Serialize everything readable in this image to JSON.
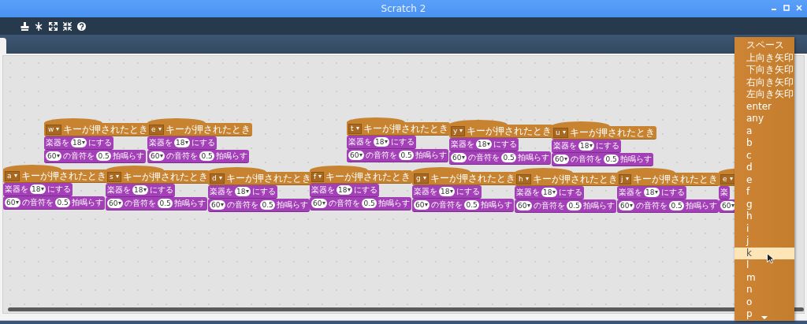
{
  "window": {
    "title": "Scratch 2"
  },
  "scripts": [
    {
      "key": "w",
      "hat_label": "キーが押されたとき",
      "instrument": {
        "label": "楽器を",
        "value": "18",
        "suffix": "にする"
      },
      "note": {
        "value": "60",
        "label": "の音符を",
        "beats": "0.5",
        "suffix": "拍鳴らす"
      }
    },
    {
      "key": "e",
      "hat_label": "キーが押されたとき",
      "instrument": {
        "label": "楽器を",
        "value": "18",
        "suffix": "にする"
      },
      "note": {
        "value": "60",
        "label": "の音符を",
        "beats": "0.5",
        "suffix": "拍鳴らす"
      }
    },
    {
      "key": "t",
      "hat_label": "キーが押されたとき",
      "instrument": {
        "label": "楽器を",
        "value": "18",
        "suffix": "にする"
      },
      "note": {
        "value": "60",
        "label": "の音符を",
        "beats": "0.5",
        "suffix": "拍鳴らす"
      }
    },
    {
      "key": "y",
      "hat_label": "キーが押されたとき",
      "instrument": {
        "label": "楽器を",
        "value": "18",
        "suffix": "にする"
      },
      "note": {
        "value": "60",
        "label": "の音符を",
        "beats": "0.5",
        "suffix": "拍鳴らす"
      }
    },
    {
      "key": "u",
      "hat_label": "キーが押されたとき",
      "instrument": {
        "label": "楽器を",
        "value": "18",
        "suffix": "にする"
      },
      "note": {
        "value": "60",
        "label": "の音符を",
        "beats": "0.5",
        "suffix": "拍鳴らす"
      }
    },
    {
      "key": "a",
      "hat_label": "キーが押されたとき",
      "instrument": {
        "label": "楽器を",
        "value": "18",
        "suffix": "にする"
      },
      "note": {
        "value": "60",
        "label": "の音符を",
        "beats": "0.5",
        "suffix": "拍鳴らす"
      }
    },
    {
      "key": "s",
      "hat_label": "キーが押されたとき",
      "instrument": {
        "label": "楽器を",
        "value": "18",
        "suffix": "にする"
      },
      "note": {
        "value": "60",
        "label": "の音符を",
        "beats": "0.5",
        "suffix": "拍鳴らす"
      }
    },
    {
      "key": "d",
      "hat_label": "キーが押されたとき",
      "instrument": {
        "label": "楽器を",
        "value": "18",
        "suffix": "にする"
      },
      "note": {
        "value": "60",
        "label": "の音符を",
        "beats": "0.5",
        "suffix": "拍鳴らす"
      }
    },
    {
      "key": "f",
      "hat_label": "キーが押されたとき",
      "instrument": {
        "label": "楽器を",
        "value": "18",
        "suffix": "にする"
      },
      "note": {
        "value": "60",
        "label": "の音符を",
        "beats": "0.5",
        "suffix": "拍鳴らす"
      }
    },
    {
      "key": "g",
      "hat_label": "キーが押されたとき",
      "instrument": {
        "label": "楽器を",
        "value": "18",
        "suffix": "にする"
      },
      "note": {
        "value": "60",
        "label": "の音符を",
        "beats": "0.5",
        "suffix": "拍鳴らす"
      }
    },
    {
      "key": "h",
      "hat_label": "キーが押されたとき",
      "instrument": {
        "label": "楽器を",
        "value": "18",
        "suffix": "にする"
      },
      "note": {
        "value": "60",
        "label": "の音符を",
        "beats": "0.5",
        "suffix": "拍鳴らす"
      }
    },
    {
      "key": "j",
      "hat_label": "キーが押されたとき",
      "instrument": {
        "label": "楽器を",
        "value": "18",
        "suffix": "にする"
      },
      "note": {
        "value": "60",
        "label": "の音符を",
        "beats": "0.5",
        "suffix": "拍鳴らす"
      }
    },
    {
      "key": "e",
      "instrument": {
        "label": "楽"
      },
      "note": {
        "value": "60"
      }
    }
  ],
  "key_menu": {
    "items": [
      {
        "label": "スペース",
        "selected": false
      },
      {
        "label": "上向き矢印",
        "selected": false
      },
      {
        "label": "下向き矢印",
        "selected": false
      },
      {
        "label": "右向き矢印",
        "selected": false
      },
      {
        "label": "左向き矢印",
        "selected": false
      },
      {
        "label": "enter",
        "selected": false
      },
      {
        "label": "any",
        "selected": false
      },
      {
        "label": "a",
        "selected": false
      },
      {
        "label": "b",
        "selected": false
      },
      {
        "label": "c",
        "selected": false
      },
      {
        "label": "d",
        "selected": false
      },
      {
        "label": "e",
        "selected": false
      },
      {
        "label": "f",
        "selected": false
      },
      {
        "label": "g",
        "selected": false
      },
      {
        "label": "h",
        "selected": false
      },
      {
        "label": "i",
        "selected": false
      },
      {
        "label": "j",
        "selected": false
      },
      {
        "label": "k",
        "selected": true
      },
      {
        "label": "l",
        "selected": false
      },
      {
        "label": "m",
        "selected": false
      },
      {
        "label": "n",
        "selected": false
      },
      {
        "label": "o",
        "selected": false
      },
      {
        "label": "p",
        "selected": false
      }
    ]
  }
}
